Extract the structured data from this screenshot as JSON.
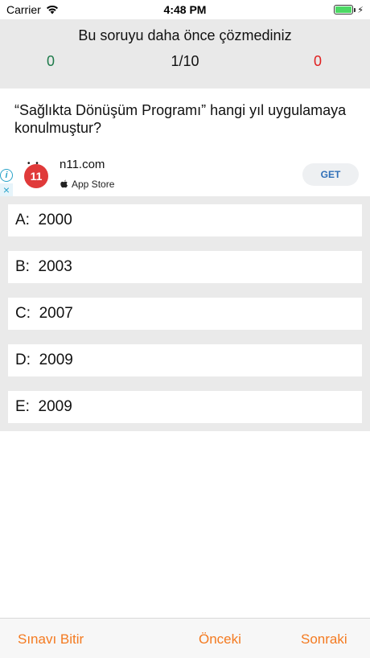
{
  "status_bar": {
    "carrier": "Carrier",
    "time": "4:48 PM",
    "battery_color": "#4cd964"
  },
  "header": {
    "message": "Bu soruyu daha önce çözmediniz",
    "correct_count": "0",
    "progress": "1/10",
    "wrong_count": "0",
    "correct_color": "#1e7a4a",
    "wrong_color": "#e02020"
  },
  "question": {
    "text": "“Sağlıkta Dönüşüm Programı” hangi yıl uygulamaya konulmuştur?"
  },
  "ad": {
    "logo_text": "11",
    "title": "n11.com",
    "store": "App Store",
    "cta": "GET",
    "info_icon": "info-icon",
    "close_icon": "close-icon"
  },
  "options": [
    {
      "letter": "A:",
      "value": "2000"
    },
    {
      "letter": "B:",
      "value": "2003"
    },
    {
      "letter": "C:",
      "value": "2007"
    },
    {
      "letter": "D:",
      "value": "2009"
    },
    {
      "letter": "E:",
      "value": "2009"
    }
  ],
  "bottom_bar": {
    "finish": "Sınavı Bitir",
    "previous": "Önceki",
    "next": "Sonraki",
    "accent_color": "#f47a20"
  }
}
